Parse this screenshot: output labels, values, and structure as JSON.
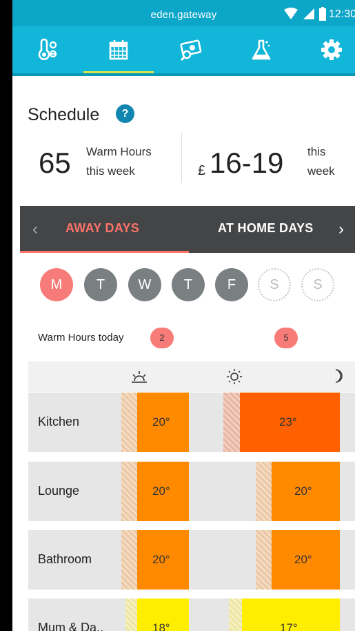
{
  "status_bar": {
    "host": "eden.gateway",
    "time": "12:30"
  },
  "nav": {
    "items": [
      {
        "name": "thermometer",
        "icon": "thermometer-icon"
      },
      {
        "name": "calendar",
        "icon": "calendar-icon",
        "selected": true
      },
      {
        "name": "finance",
        "icon": "money-search-icon"
      },
      {
        "name": "lab",
        "icon": "flask-icon"
      },
      {
        "name": "settings",
        "icon": "gear-icon"
      }
    ],
    "accent_underline": "#d6e64a",
    "background": "#12b6d8"
  },
  "schedule": {
    "title": "Schedule",
    "help": "?",
    "warm_hours_value": "65",
    "warm_hours_label_1": "Warm Hours",
    "warm_hours_label_2": "this week",
    "cost_currency": "£",
    "cost_value": "16-19",
    "cost_label_1": "this",
    "cost_label_2": "week"
  },
  "day_type": {
    "left_arrow": "‹",
    "right_arrow": "›",
    "tabs": [
      "AWAY DAYS",
      "AT HOME DAYS"
    ],
    "active_tab": "AWAY DAYS",
    "accent": "#ff7369"
  },
  "days": [
    {
      "label": "M",
      "state": "active"
    },
    {
      "label": "T",
      "state": "weekday"
    },
    {
      "label": "W",
      "state": "weekday"
    },
    {
      "label": "T",
      "state": "weekday"
    },
    {
      "label": "F",
      "state": "weekday"
    },
    {
      "label": "S",
      "state": "weekend"
    },
    {
      "label": "S",
      "state": "weekend"
    }
  ],
  "warm_hours_today": {
    "label": "Warm Hours today",
    "morning": "2",
    "evening": "5"
  },
  "time_icons": [
    "sunrise-icon",
    "sun-icon",
    "moon-icon"
  ],
  "rooms": [
    {
      "name": "Kitchen",
      "morning_temp": "20°",
      "evening_temp": "23°"
    },
    {
      "name": "Lounge",
      "morning_temp": "20°",
      "evening_temp": "20°"
    },
    {
      "name": "Bathroom",
      "morning_temp": "20°",
      "evening_temp": "20°"
    },
    {
      "name": "Mum & Da..",
      "morning_temp": "18°",
      "evening_temp": "17°"
    }
  ],
  "colors": {
    "warm_20": "#ff8a00",
    "warm_23": "#ff6100",
    "warm_18": "#ffee00",
    "warm_17": "#ffee00"
  }
}
